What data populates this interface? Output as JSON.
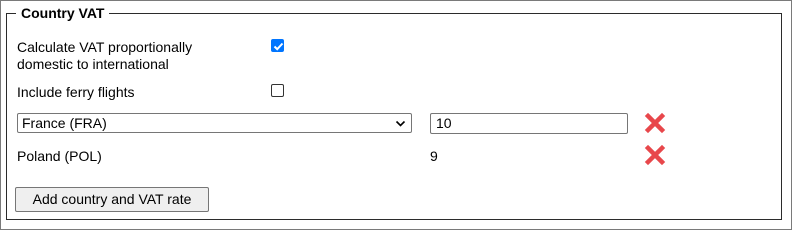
{
  "fieldset": {
    "legend": "Country VAT"
  },
  "options": {
    "proportional": {
      "label_line1": "Calculate VAT proportionally",
      "label_line2": "domestic to international",
      "checked": true
    },
    "ferry": {
      "label": "Include ferry flights",
      "checked": false
    }
  },
  "rows": [
    {
      "country": "France (FRA)",
      "rate": "10",
      "editable": true
    },
    {
      "country": "Poland (POL)",
      "rate": "9",
      "editable": false
    }
  ],
  "actions": {
    "add_label": "Add country and VAT rate"
  },
  "colors": {
    "checkbox_accent": "#0075ff",
    "delete_icon": "#e8474b"
  }
}
